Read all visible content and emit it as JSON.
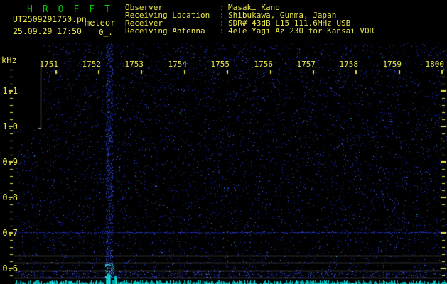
{
  "header": {
    "title": "HROFFT",
    "filename": "UT2509291750.pn",
    "mode_label": "meteor",
    "datetime": "25.09.29 17:50",
    "counter": "0_.",
    "colon": ":",
    "info": [
      {
        "label": "Observer",
        "value": "Masaki Kano"
      },
      {
        "label": "Receiving Location",
        "value": "Shibukawa, Gunma, Japan"
      },
      {
        "label": "Receiver",
        "value": "SDR# 43dB L15 111.6MHz USB"
      },
      {
        "label": "Receiving Antenna",
        "value": "4ele Yagi Az 230 for Kansai VOR"
      }
    ]
  },
  "chart_data": {
    "type": "heatmap",
    "title": "HROFFT 10-minute radio meteor echo spectrogram (UT 1750-1800, 25.09.29)",
    "x_axis": {
      "unit": "UT time HHMM",
      "start": "1750",
      "end": "1800",
      "ticks": [
        "1751",
        "1752",
        "1753",
        "1754",
        "1755",
        "1756",
        "1757",
        "1758",
        "1759",
        "1800"
      ]
    },
    "y_axis": {
      "unit": "kHz",
      "min": 0.57,
      "max": 1.17,
      "major_tick_values": [
        1.1,
        1.0,
        0.9,
        0.8,
        0.7,
        0.6
      ],
      "tick_labels": [
        "1.1",
        "1.0",
        "0.9",
        "0.8",
        "0.7",
        "0.6"
      ],
      "minor_step_khz": 0.02
    },
    "features": {
      "background": "sparse dark-blue noise speckle on black",
      "carrier_line": {
        "freq_khz": 0.7,
        "appearance": "faint dotted blue horizontal line across full width"
      },
      "interference_stripe": {
        "time": "1752:15",
        "appearance": "vertical band of dense blue noise spanning full height with bright cyan burst near bottom"
      },
      "reference_lines_khz": [
        0.636,
        0.616,
        0.594,
        0.574
      ],
      "level_trace": "cyan signal-level bars along bottom edge, tall burst near 1752",
      "meteor_echo_count_shown": "0"
    },
    "colors": {
      "background": "#000000",
      "noise_blue": "#2438c8",
      "trace_cyan": "#00c2c2",
      "axis_yellow": "#e8e44c",
      "title_green": "#00cc00",
      "grid_grey": "#989898"
    }
  }
}
